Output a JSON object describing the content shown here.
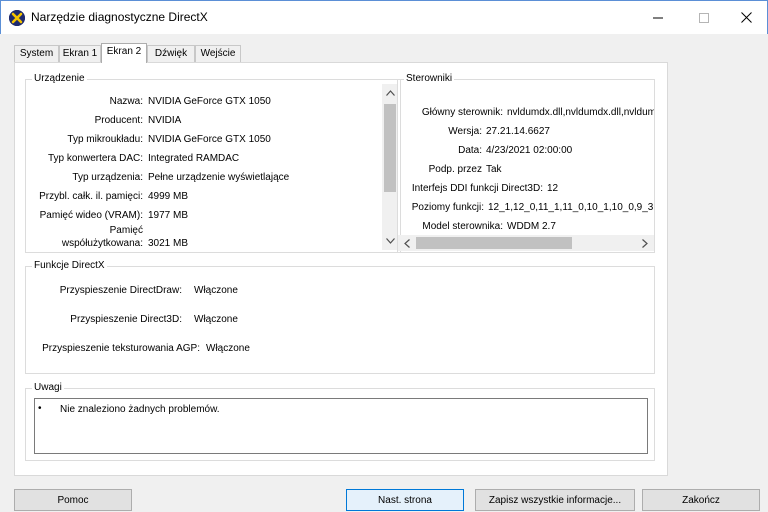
{
  "window": {
    "title": "Narzędzie diagnostyczne DirectX",
    "icon": "directx-icon"
  },
  "tabs": [
    {
      "label": "System",
      "active": false
    },
    {
      "label": "Ekran 1",
      "active": false
    },
    {
      "label": "Ekran 2",
      "active": true
    },
    {
      "label": "Dźwięk",
      "active": false
    },
    {
      "label": "Wejście",
      "active": false
    }
  ],
  "device": {
    "group_label": "Urządzenie",
    "rows": [
      {
        "label": "Nazwa:",
        "value": "NVIDIA GeForce GTX 1050"
      },
      {
        "label": "Producent:",
        "value": "NVIDIA"
      },
      {
        "label": "Typ mikroukładu:",
        "value": "NVIDIA GeForce GTX 1050"
      },
      {
        "label": "Typ konwertera DAC:",
        "value": "Integrated RAMDAC"
      },
      {
        "label": "Typ urządzenia:",
        "value": "Pełne urządzenie wyświetlające"
      },
      {
        "label": "Przybl. całk. il. pamięci:",
        "value": "4999 MB"
      },
      {
        "label": "Pamięć wideo (VRAM):",
        "value": "1977 MB"
      },
      {
        "label_line1": "Pamięć",
        "label_line2": "współużytkowana:",
        "value": "3021 MB"
      }
    ]
  },
  "drivers": {
    "group_label": "Sterowniki",
    "rows": [
      {
        "label": "Główny sterownik:",
        "value": "nvldumdx.dll,nvldumdx.dll,nvldum"
      },
      {
        "label": "Wersja:",
        "value": "27.21.14.6627"
      },
      {
        "label": "Data:",
        "value": "4/23/2021 02:00:00"
      },
      {
        "label": "Podp. przez",
        "value": "Tak"
      },
      {
        "label": "Interfejs DDI funkcji Direct3D:",
        "value": "12"
      },
      {
        "label": "Poziomy funkcji:",
        "value": "12_1,12_0,11_1,11_0,10_1,10_0,9_3,"
      },
      {
        "label": "Model sterownika:",
        "value": "WDDM 2.7"
      }
    ]
  },
  "features": {
    "group_label": "Funkcje DirectX",
    "rows": [
      {
        "label": "Przyspieszenie DirectDraw:",
        "value": "Włączone"
      },
      {
        "label": "Przyspieszenie Direct3D:",
        "value": "Włączone"
      },
      {
        "label": "Przyspieszenie teksturowania AGP:",
        "value": "Włączone"
      }
    ]
  },
  "notes": {
    "group_label": "Uwagi",
    "bullet": "•",
    "text": "Nie znaleziono żadnych problemów."
  },
  "buttons": {
    "help": "Pomoc",
    "next": "Nast. strona",
    "save_all": "Zapisz wszystkie informacje...",
    "exit": "Zakończ"
  }
}
